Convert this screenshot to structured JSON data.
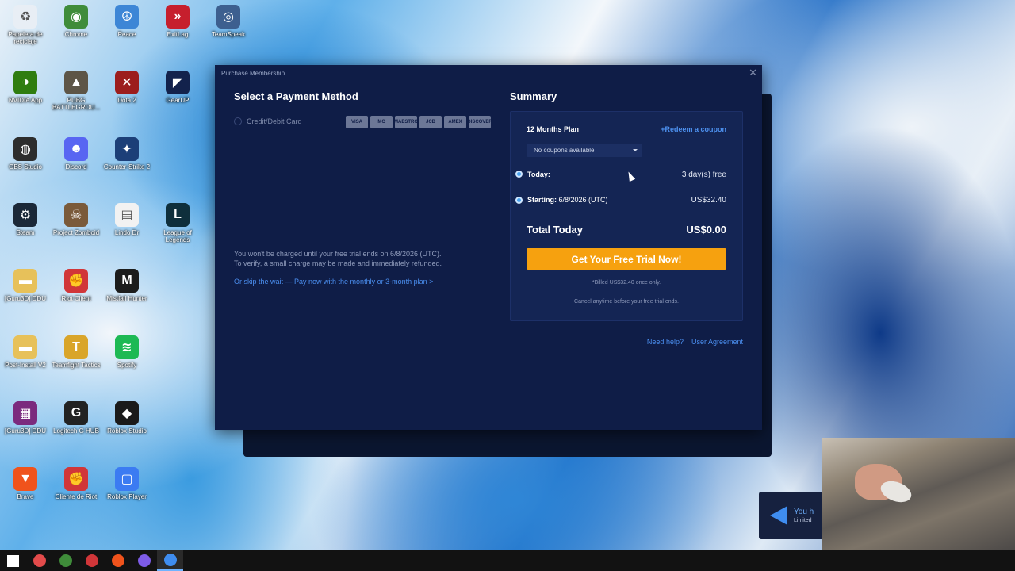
{
  "desktop_icons": [
    {
      "label": "Papelera de reciclaje",
      "icon": "recycle-bin-icon",
      "color": "#e8eef5",
      "glyph": "♻"
    },
    {
      "label": "Chrome",
      "icon": "chrome-icon",
      "color": "#3f8c3a",
      "glyph": "◉"
    },
    {
      "label": "Peace",
      "icon": "peace-icon",
      "color": "#3d86d6",
      "glyph": "☮"
    },
    {
      "label": "ExitLag",
      "icon": "exitlag-icon",
      "color": "#c61f2d",
      "glyph": "»"
    },
    {
      "label": "TeamSpeak",
      "icon": "teamspeak-icon",
      "color": "#3d5f8f",
      "glyph": "◎"
    },
    {
      "label": "NVIDIA App",
      "icon": "nvidia-icon",
      "color": "#2f7d10",
      "glyph": "◑"
    },
    {
      "label": "PUBG BATTLEGROU...",
      "icon": "pubg-icon",
      "color": "#5d5547",
      "glyph": "▲"
    },
    {
      "label": "Dota 2",
      "icon": "dota2-icon",
      "color": "#9c1d1d",
      "glyph": "✕"
    },
    {
      "label": "GearUP",
      "icon": "gearup-icon",
      "color": "#13224c",
      "glyph": "◤"
    },
    {
      "label": "OBS Studio",
      "icon": "obs-icon",
      "color": "#2d2d2d",
      "glyph": "◍"
    },
    {
      "label": "Discord",
      "icon": "discord-icon",
      "color": "#5865f2",
      "glyph": "☻"
    },
    {
      "label": "Counter-Strike 2",
      "icon": "cs2-icon",
      "color": "#1c3f78",
      "glyph": "✦"
    },
    {
      "label": "Steam",
      "icon": "steam-icon",
      "color": "#1b2838",
      "glyph": "⚙"
    },
    {
      "label": "Project Zomboid",
      "icon": "zomboid-icon",
      "color": "#7a5a3a",
      "glyph": "☠"
    },
    {
      "label": "Lindo Dr",
      "icon": "file-icon",
      "color": "#f2f2f2",
      "glyph": "▤"
    },
    {
      "label": "League of Legends",
      "icon": "lol-icon",
      "color": "#0f2f3c",
      "glyph": "L"
    },
    {
      "label": "[Guru3D] DDU",
      "icon": "folder-icon",
      "color": "#e7c15a",
      "glyph": "▬"
    },
    {
      "label": "Riot Client",
      "icon": "riot-icon",
      "color": "#d13639",
      "glyph": "✊"
    },
    {
      "label": "Mistfall Hunter",
      "icon": "mistfall-icon",
      "color": "#1c1c1c",
      "glyph": "M"
    },
    {
      "label": "Post-Install V2",
      "icon": "folder-icon",
      "color": "#e7c15a",
      "glyph": "▬"
    },
    {
      "label": "Teamfight Tactics",
      "icon": "tft-icon",
      "color": "#d9a52a",
      "glyph": "T"
    },
    {
      "label": "Spotify",
      "icon": "spotify-icon",
      "color": "#1db954",
      "glyph": "≋"
    },
    {
      "label": "[Guru3D] DDU",
      "icon": "winrar-icon",
      "color": "#7b2a7e",
      "glyph": "▦"
    },
    {
      "label": "Logitech G HUB",
      "icon": "ghub-icon",
      "color": "#222222",
      "glyph": "G"
    },
    {
      "label": "Roblox Studio",
      "icon": "roblox-studio-icon",
      "color": "#1a1a1a",
      "glyph": "◆"
    },
    {
      "label": "Brave",
      "icon": "brave-icon",
      "color": "#f0531c",
      "glyph": "▼"
    },
    {
      "label": "Cliente de Riot",
      "icon": "riot-icon",
      "color": "#d13639",
      "glyph": "✊"
    },
    {
      "label": "Roblox Player",
      "icon": "roblox-icon",
      "color": "#3b7bf2",
      "glyph": "▢"
    }
  ],
  "dialog": {
    "title": "Purchase Membership",
    "close_glyph": "✕",
    "payment": {
      "heading": "Select a Payment Method",
      "option_label": "Credit/Debit Card",
      "cards": [
        "VISA",
        "MC",
        "MAESTRO",
        "JCB",
        "AMEX",
        "DISCOVER"
      ]
    },
    "trial_note_line1": "You won't be charged until your free trial ends on 6/8/2026 (UTC).",
    "trial_note_line2": "To verify, a small charge may be made and immediately refunded.",
    "skip_link": "Or skip the wait — Pay now with the monthly or 3-month plan >",
    "summary": {
      "heading": "Summary",
      "plan_name": "12 Months Plan",
      "redeem_label": "+Redeem a coupon",
      "coupon_select": "No coupons available",
      "today_label": "Today:",
      "today_value": "3 day(s) free",
      "starting_label": "Starting:",
      "starting_date": "6/8/2026 (UTC)",
      "starting_value": "US$32.40",
      "total_label": "Total Today",
      "total_value": "US$0.00",
      "cta_label": "Get Your Free Trial Now!",
      "billed_note": "*Billed US$32.40 once only.",
      "cancel_note": "Cancel anytime before your free trial ends."
    },
    "footer": {
      "help_link": "Need help?",
      "agreement_link": "User Agreement"
    },
    "accent_color": "#f6a10f",
    "link_color": "#4b8ff0"
  },
  "toast": {
    "title": "You h",
    "subtitle": "Limited"
  },
  "taskbar": {
    "items": [
      {
        "icon": "windows-start-icon",
        "color": "#ffffff"
      },
      {
        "icon": "screen-recorder-icon",
        "color": "#e34b4b"
      },
      {
        "icon": "chrome-icon",
        "color": "#3f8c3a"
      },
      {
        "icon": "riot-icon",
        "color": "#d13639"
      },
      {
        "icon": "brave-icon",
        "color": "#f0531c"
      },
      {
        "icon": "multi-app-icon",
        "color": "#7e5ce8"
      },
      {
        "icon": "gearup-icon",
        "color": "#3f8df0"
      }
    ]
  }
}
